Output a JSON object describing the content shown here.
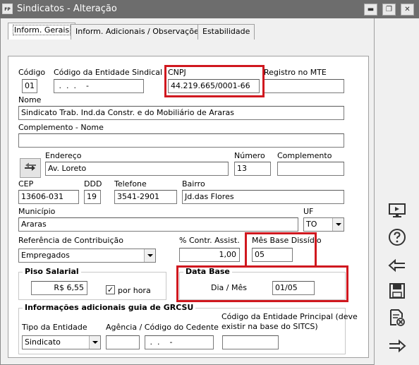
{
  "window": {
    "app_icon": "FP",
    "title": "Sindicatos - Alteração",
    "minimize": "▬",
    "maximize": "❐",
    "close": "✕"
  },
  "tabs": [
    {
      "label": "Inform. Gerais",
      "active": true
    },
    {
      "label": "Inform. Adicionais / Observações",
      "active": false
    },
    {
      "label": "Estabilidade",
      "active": false
    }
  ],
  "form": {
    "codigo_label": "Código",
    "codigo_value": "01",
    "codigo_entidade_label": "Código da Entidade Sindical",
    "codigo_entidade_value": " .  .  .    -",
    "cnpj_label": "CNPJ",
    "cnpj_value": "44.219.665/0001-66",
    "registro_mte_label": "Registro no MTE",
    "registro_mte_value": "",
    "nome_label": "Nome",
    "nome_value": "Sindicato Trab. Ind.da Constr. e do Mobiliário de Araras",
    "complemento_nome_label": "Complemento - Nome",
    "complemento_nome_value": "",
    "endereco_label": "Endereço",
    "endereco_value": "Av. Loreto",
    "numero_label": "Número",
    "numero_value": "13",
    "complemento_label": "Complemento",
    "complemento_value": "",
    "cep_label": "CEP",
    "cep_value": "13606-031",
    "ddd_label": "DDD",
    "ddd_value": "19",
    "telefone_label": "Telefone",
    "telefone_value": "3541-2901",
    "bairro_label": "Bairro",
    "bairro_value": "Jd.das Flores",
    "municipio_label": "Município",
    "municipio_value": "Araras",
    "uf_label": "UF",
    "uf_value": "TO",
    "referencia_label": "Referência de Contribuição",
    "referencia_value": "Empregados",
    "contr_assist_label": "% Contr. Assist.",
    "contr_assist_value": "1,00",
    "mes_base_label": "Mês Base Dissídio",
    "mes_base_value": "05"
  },
  "piso": {
    "title": "Piso Salarial",
    "value": "R$ 6,55",
    "por_hora_label": "por hora",
    "por_hora_checked": "✓"
  },
  "data_base": {
    "title": "Data Base",
    "label": "Dia / Mês",
    "value": "01/05"
  },
  "grcsu": {
    "title": "Informações adicionais guia de GRCSU",
    "tipo_label": "Tipo da Entidade",
    "tipo_value": "Sindicato",
    "agencia_label": "Agência / Código do Cedente",
    "agencia_value": "",
    "cedente_value": " .  .    -",
    "entidade_principal_label_1": "Código da Entidade Principal (deve",
    "entidade_principal_label_2": "existir na base do SITCS)",
    "entidade_principal_value": ""
  },
  "sidebar_icons": [
    "monitor-icon",
    "help-icon",
    "back-arrow-icon",
    "save-icon",
    "cancel-document-icon",
    "forward-arrow-icon"
  ],
  "colors": {
    "highlight": "#d0181f",
    "titlebar": "#6d6d6d"
  }
}
